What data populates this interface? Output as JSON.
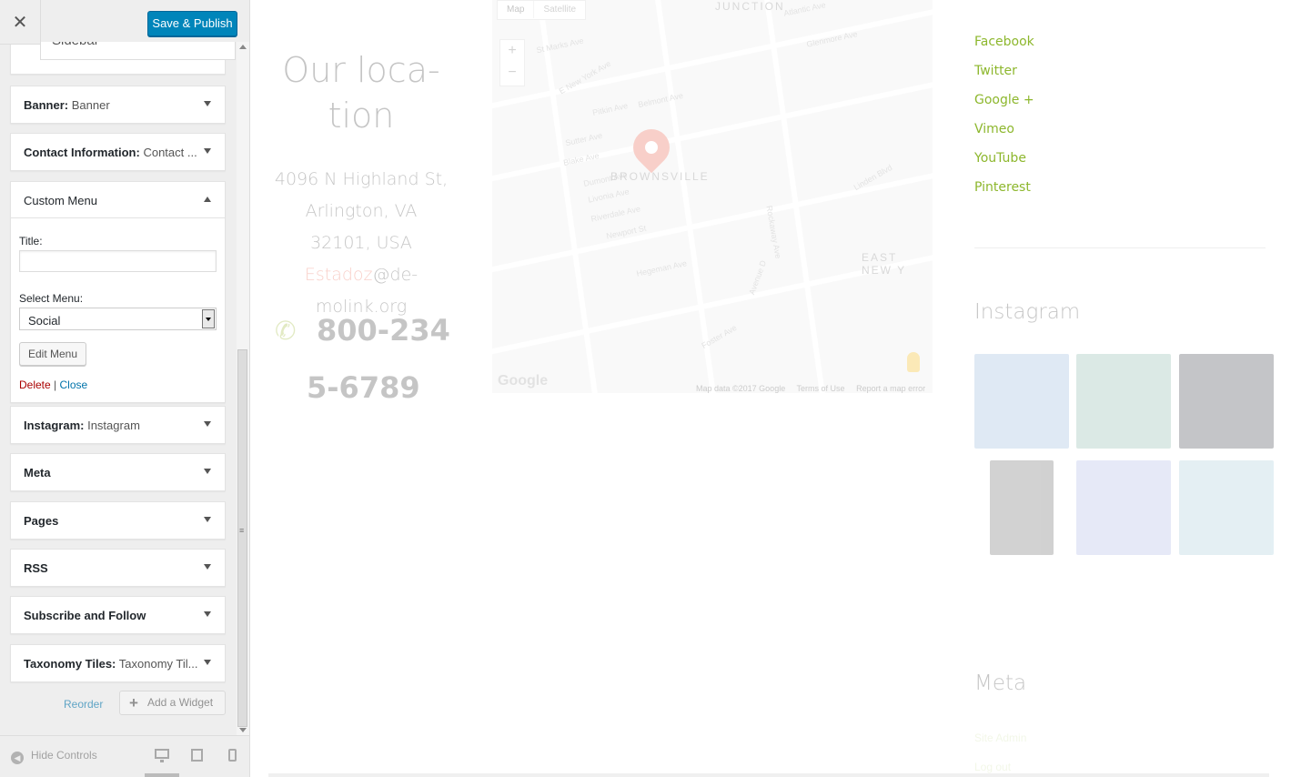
{
  "customizer": {
    "close_glyph": "✕",
    "save_label": "Save & Publish",
    "section_peek": "Sidebar",
    "widgets": [
      {
        "name": "Banner:",
        "sub": "Banner"
      },
      {
        "name": "Contact Information:",
        "sub": "Contact ..."
      },
      {
        "name": "Custom Menu",
        "sub": ""
      },
      {
        "name": "Instagram:",
        "sub": "Instagram"
      },
      {
        "name": "Meta",
        "sub": ""
      },
      {
        "name": "Pages",
        "sub": ""
      },
      {
        "name": "RSS",
        "sub": ""
      },
      {
        "name": "Subscribe and Follow",
        "sub": ""
      },
      {
        "name": "Taxonomy Tiles:",
        "sub": "Taxonomy Til..."
      }
    ],
    "custom_menu_form": {
      "title_label": "Title:",
      "title_value": "",
      "select_label": "Select Menu:",
      "select_value": "Social",
      "edit_menu_label": "Edit Menu",
      "delete_label": "Delete",
      "separator": "|",
      "close_label": "Close"
    },
    "reorder_label": "Reorder",
    "add_widget_label": "Add a Widget",
    "hide_controls_label": "Hide Controls"
  },
  "preview": {
    "location_title": "Our loca- tion",
    "address_line1": "4096 N Highland St, Arlington, VA 32101, USA ",
    "address_accent": "Estadoz",
    "address_line2": "@de-molink.org",
    "phone_line1": "800-234",
    "phone_line2": "5-6789",
    "map": {
      "tab_map": "Map",
      "tab_satellite": "Satellite",
      "zoom_in": "+",
      "zoom_out": "−",
      "neighborhood_1": "BROWNSVILLE",
      "neighborhood_2": "EAST NEW Y",
      "neighborhood_3": "JUNCTION",
      "streets": [
        "Pitkin Ave",
        "Sutter Ave",
        "Blake Ave",
        "Dumont Ave",
        "Livonia Ave",
        "Riverdale Ave",
        "Newport St",
        "Hegeman Ave",
        "Rockaway Ave",
        "Belmont Ave",
        "Atlantic Ave",
        "Glenmore Ave",
        "E New York Ave",
        "St Marks Ave",
        "Linden Blvd",
        "Foster Ave",
        "Avenue D"
      ],
      "logo": "Google",
      "data_label": "Map data ©2017 Google",
      "terms_label": "Terms of Use",
      "report_label": "Report a map error"
    },
    "social_links": [
      "Facebook",
      "Twitter",
      "Google +",
      "Vimeo",
      "YouTube",
      "Pinterest"
    ],
    "instagram_title": "Instagram",
    "instagram_tile_colors": [
      "#8fb4d9",
      "#7fb3a5",
      "#30343c",
      "#5d5d5d",
      "#a9b3e6",
      "#9fc9d6"
    ],
    "meta_title": "Meta",
    "meta_links": [
      "Site Admin",
      "Log out"
    ]
  }
}
